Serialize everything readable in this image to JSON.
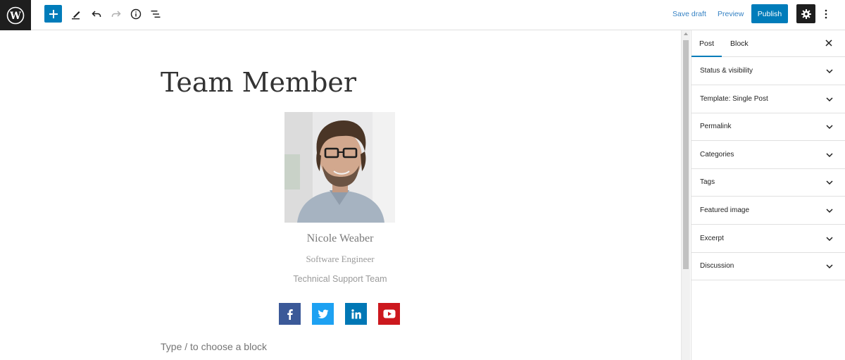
{
  "toolbar": {
    "save_draft_label": "Save draft",
    "preview_label": "Preview",
    "publish_label": "Publish"
  },
  "colors": {
    "accent": "#007cba",
    "dark": "#1e1e1e",
    "facebook": "#3b5998",
    "twitter": "#1da1f2",
    "linkedin": "#0077b5",
    "youtube": "#cc181e"
  },
  "editor": {
    "post_title": "Team Member",
    "member": {
      "name": "Nicole Weaber",
      "role": "Software Engineer",
      "team": "Technical Support Team"
    },
    "social_icons": [
      "facebook-icon",
      "twitter-icon",
      "linkedin-icon",
      "youtube-icon"
    ],
    "block_placeholder": "Type / to choose a block"
  },
  "sidebar": {
    "tabs": [
      {
        "label": "Post",
        "active": true
      },
      {
        "label": "Block",
        "active": false
      }
    ],
    "panels": [
      {
        "label": "Status & visibility"
      },
      {
        "label": "Template: Single Post"
      },
      {
        "label": "Permalink"
      },
      {
        "label": "Categories"
      },
      {
        "label": "Tags"
      },
      {
        "label": "Featured image"
      },
      {
        "label": "Excerpt"
      },
      {
        "label": "Discussion"
      }
    ]
  }
}
